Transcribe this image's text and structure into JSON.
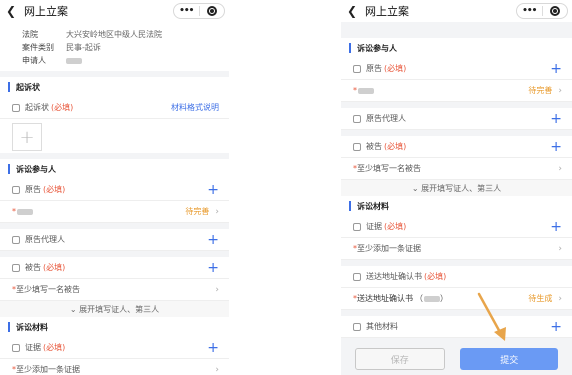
{
  "left": {
    "header": {
      "title": "网上立案"
    },
    "info": [
      {
        "k": "法院",
        "v": "大兴安岭地区中级人民法院"
      },
      {
        "k": "案件类别",
        "v": "民事-起诉"
      },
      {
        "k": "申请人",
        "v": ""
      }
    ],
    "complaint": {
      "title": "起诉状",
      "doc_label": "起诉状",
      "req": "(必填)",
      "link": "材料格式说明"
    },
    "parties": {
      "title": "诉讼参与人",
      "plaintiff": "原告",
      "req": "(必填)",
      "pending": "待完善",
      "agent": "原告代理人",
      "defendant": "被告",
      "defendant_hint": "至少填写一名被告",
      "expand": "展开填写证人、第三人"
    },
    "materials": {
      "title": "诉讼材料",
      "evidence": "证据",
      "req": "(必填)",
      "evidence_hint": "至少添加一条证据"
    }
  },
  "right": {
    "header": {
      "title": "网上立案"
    },
    "parties": {
      "title": "诉讼参与人",
      "plaintiff": "原告",
      "req": "(必填)",
      "pending": "待完善",
      "agent": "原告代理人",
      "defendant": "被告",
      "defendant_hint": "至少填写一名被告",
      "expand": "展开填写证人、第三人"
    },
    "materials": {
      "title": "诉讼材料",
      "evidence": "证据",
      "req": "(必填)",
      "evidence_hint": "至少添加一条证据",
      "service": "送达地址确认书",
      "service_req": "(必填)",
      "service_row": "送达地址确认书",
      "service_status": "待生成",
      "other": "其他材料"
    },
    "footer": {
      "save": "保存",
      "submit": "提交"
    }
  },
  "colors": {
    "accent": "#3d6fe6",
    "required": "#e8573b",
    "pending": "#e89a2b",
    "submit": "#6a9af4",
    "arrow": "#e8a54b"
  },
  "icons": [
    "back-icon",
    "more-dots-icon",
    "close-target-icon",
    "plus-icon",
    "chevron-right-icon",
    "person-icon",
    "document-icon"
  ]
}
